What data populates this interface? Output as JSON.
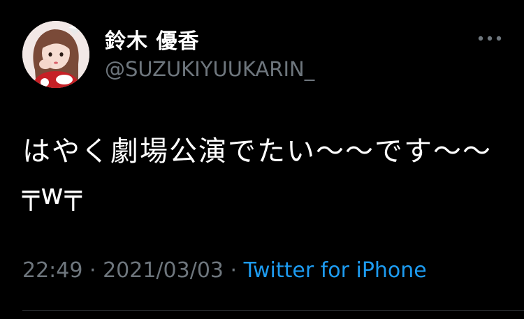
{
  "user": {
    "display_name": "鈴木 優香",
    "handle": "@SUZUKIYUUKARIN_"
  },
  "tweet": {
    "text": "はやく劇場公演でたい〜〜です〜〜╤w╤"
  },
  "meta": {
    "time": "22:49",
    "sep1": " · ",
    "date": "2021/03/03",
    "sep2": " · ",
    "source": "Twitter for iPhone"
  },
  "icons": {
    "more": "more-dots-icon",
    "avatar": "profile-photo"
  },
  "colors": {
    "background": "#000000",
    "text": "#ffffff",
    "secondary": "#6e767d",
    "link": "#1d9bf0"
  }
}
